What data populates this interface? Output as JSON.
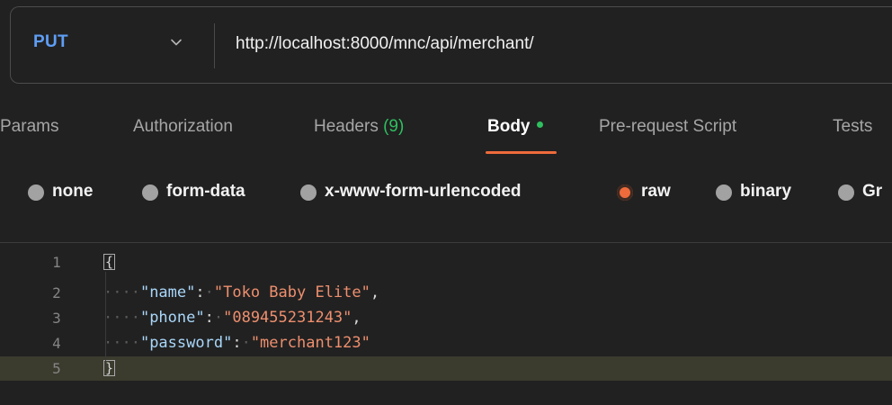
{
  "request": {
    "method": "PUT",
    "url": "http://localhost:8000/mnc/api/merchant/"
  },
  "tabs": [
    {
      "label": "Params"
    },
    {
      "label": "Authorization"
    },
    {
      "label": "Headers",
      "count": "(9)"
    },
    {
      "label": "Body"
    },
    {
      "label": "Pre-request Script"
    },
    {
      "label": "Tests"
    }
  ],
  "body_types": [
    {
      "label": "none"
    },
    {
      "label": "form-data"
    },
    {
      "label": "x-www-form-urlencoded"
    },
    {
      "label": "raw"
    },
    {
      "label": "binary"
    },
    {
      "label": "Gr"
    }
  ],
  "editor": {
    "lines": [
      {
        "number": "1",
        "open": "{"
      },
      {
        "number": "2",
        "key": "\"name\"",
        "value": "\"Toko Baby Elite\""
      },
      {
        "number": "3",
        "key": "\"phone\"",
        "value": "\"089455231243\""
      },
      {
        "number": "4",
        "key": "\"password\"",
        "value": "\"merchant123\""
      },
      {
        "number": "5",
        "close": "}"
      }
    ],
    "indent_dots": "····",
    "colon": ":",
    "dot": "·",
    "comma": ","
  },
  "colors": {
    "accent": "#ef6b3b",
    "method": "#5e9ef6",
    "status_green": "#2fbf5f"
  },
  "icons": {
    "method_dropdown": "chevron-down-icon",
    "body_indicator": "dot-indicator"
  }
}
